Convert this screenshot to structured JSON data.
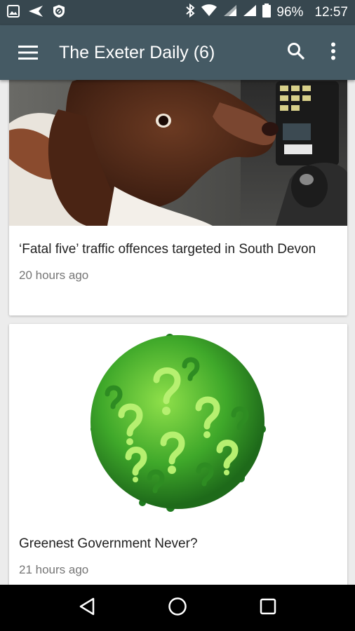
{
  "status_bar": {
    "battery": "96%",
    "time": "12:57",
    "icons": [
      "image-icon",
      "send-icon",
      "shield-icon",
      "bluetooth-icon",
      "wifi-icon",
      "signal-icon",
      "signal-icon",
      "battery-icon"
    ]
  },
  "app_bar": {
    "title": "The Exeter Daily (6)",
    "menu_icon": "menu-icon",
    "search_icon": "search-icon",
    "more_icon": "more-vert-icon"
  },
  "articles": [
    {
      "title": "‘Fatal five’ traffic offences targeted in South Devon",
      "time": "20 hours ago",
      "image": "dog-photo"
    },
    {
      "title": "Greenest Government Never?",
      "time": "21 hours ago",
      "image": "green-question-marks-ball"
    }
  ],
  "nav_bar": {
    "icons": [
      "back-icon",
      "home-icon",
      "recents-icon"
    ]
  },
  "colors": {
    "status_bar": "#37474f",
    "app_bar": "#455a64",
    "background": "#ececec",
    "time_text": "#757575"
  }
}
